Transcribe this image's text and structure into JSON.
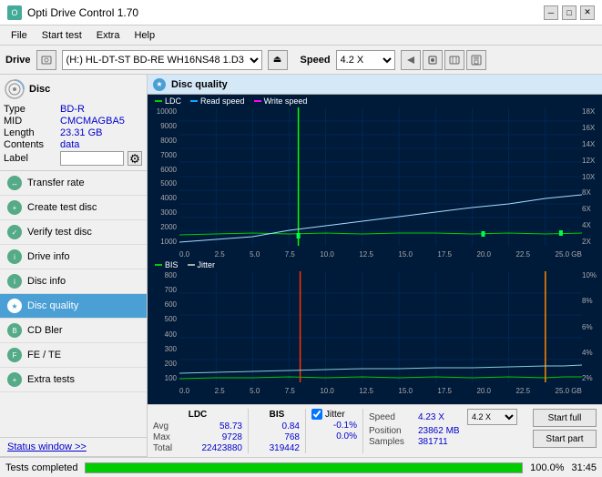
{
  "titleBar": {
    "title": "Opti Drive Control 1.70",
    "icon": "O",
    "minBtn": "─",
    "maxBtn": "□",
    "closeBtn": "✕"
  },
  "menuBar": {
    "items": [
      "File",
      "Start test",
      "Extra",
      "Help"
    ]
  },
  "driveBar": {
    "driveLabel": "Drive",
    "driveValue": "(H:) HL-DT-ST BD-RE  WH16NS48 1.D3",
    "speedLabel": "Speed",
    "speedValue": "4.2 X"
  },
  "disc": {
    "title": "Disc",
    "typeLabel": "Type",
    "typeValue": "BD-R",
    "midLabel": "MID",
    "midValue": "CMCMAGBA5",
    "lengthLabel": "Length",
    "lengthValue": "23.31 GB",
    "contentsLabel": "Contents",
    "contentsValue": "data",
    "labelLabel": "Label"
  },
  "nav": {
    "items": [
      {
        "label": "Transfer rate",
        "id": "transfer-rate"
      },
      {
        "label": "Create test disc",
        "id": "create-test-disc"
      },
      {
        "label": "Verify test disc",
        "id": "verify-test-disc"
      },
      {
        "label": "Drive info",
        "id": "drive-info"
      },
      {
        "label": "Disc info",
        "id": "disc-info"
      },
      {
        "label": "Disc quality",
        "id": "disc-quality",
        "active": true
      },
      {
        "label": "CD Bler",
        "id": "cd-bler"
      },
      {
        "label": "FE / TE",
        "id": "fe-te"
      },
      {
        "label": "Extra tests",
        "id": "extra-tests"
      }
    ]
  },
  "statusWindowLink": "Status window >>",
  "chart": {
    "title": "Disc quality",
    "legend": {
      "ldc": "LDC",
      "readSpeed": "Read speed",
      "writeSpeed": "Write speed",
      "bis": "BIS",
      "jitter": "Jitter"
    },
    "topChart": {
      "yLabels": [
        "10000",
        "9000",
        "8000",
        "7000",
        "6000",
        "5000",
        "4000",
        "3000",
        "2000",
        "1000"
      ],
      "yLabelsRight": [
        "18X",
        "16X",
        "14X",
        "12X",
        "10X",
        "8X",
        "6X",
        "4X",
        "2X"
      ],
      "xLabels": [
        "0.0",
        "2.5",
        "5.0",
        "7.5",
        "10.0",
        "12.5",
        "15.0",
        "17.5",
        "20.0",
        "22.5",
        "25.0 GB"
      ]
    },
    "bottomChart": {
      "yLabels": [
        "800",
        "700",
        "600",
        "500",
        "400",
        "300",
        "200",
        "100"
      ],
      "yLabelsRight": [
        "10%",
        "8%",
        "6%",
        "4%",
        "2%"
      ],
      "xLabels": [
        "0.0",
        "2.5",
        "5.0",
        "7.5",
        "10.0",
        "12.5",
        "15.0",
        "17.5",
        "20.0",
        "22.5",
        "25.0 GB"
      ]
    }
  },
  "stats": {
    "ldcHeader": "LDC",
    "bisHeader": "BIS",
    "jitterHeader": "Jitter",
    "avgLabel": "Avg",
    "maxLabel": "Max",
    "totalLabel": "Total",
    "ldcAvg": "58.73",
    "ldcMax": "9728",
    "ldcTotal": "22423880",
    "bisAvg": "0.84",
    "bisMax": "768",
    "bisTotal": "319442",
    "jitterAvg": "-0.1%",
    "jitterMax": "0.0%",
    "speedLabel": "Speed",
    "speedValue": "4.23 X",
    "speedSelectValue": "4.2 X",
    "positionLabel": "Position",
    "positionValue": "23862 MB",
    "samplesLabel": "Samples",
    "samplesValue": "381711",
    "startFullBtn": "Start full",
    "startPartBtn": "Start part"
  },
  "statusBar": {
    "statusText": "Tests completed",
    "progressPercent": 100,
    "progressLabel": "100.0%",
    "time": "31:45"
  }
}
